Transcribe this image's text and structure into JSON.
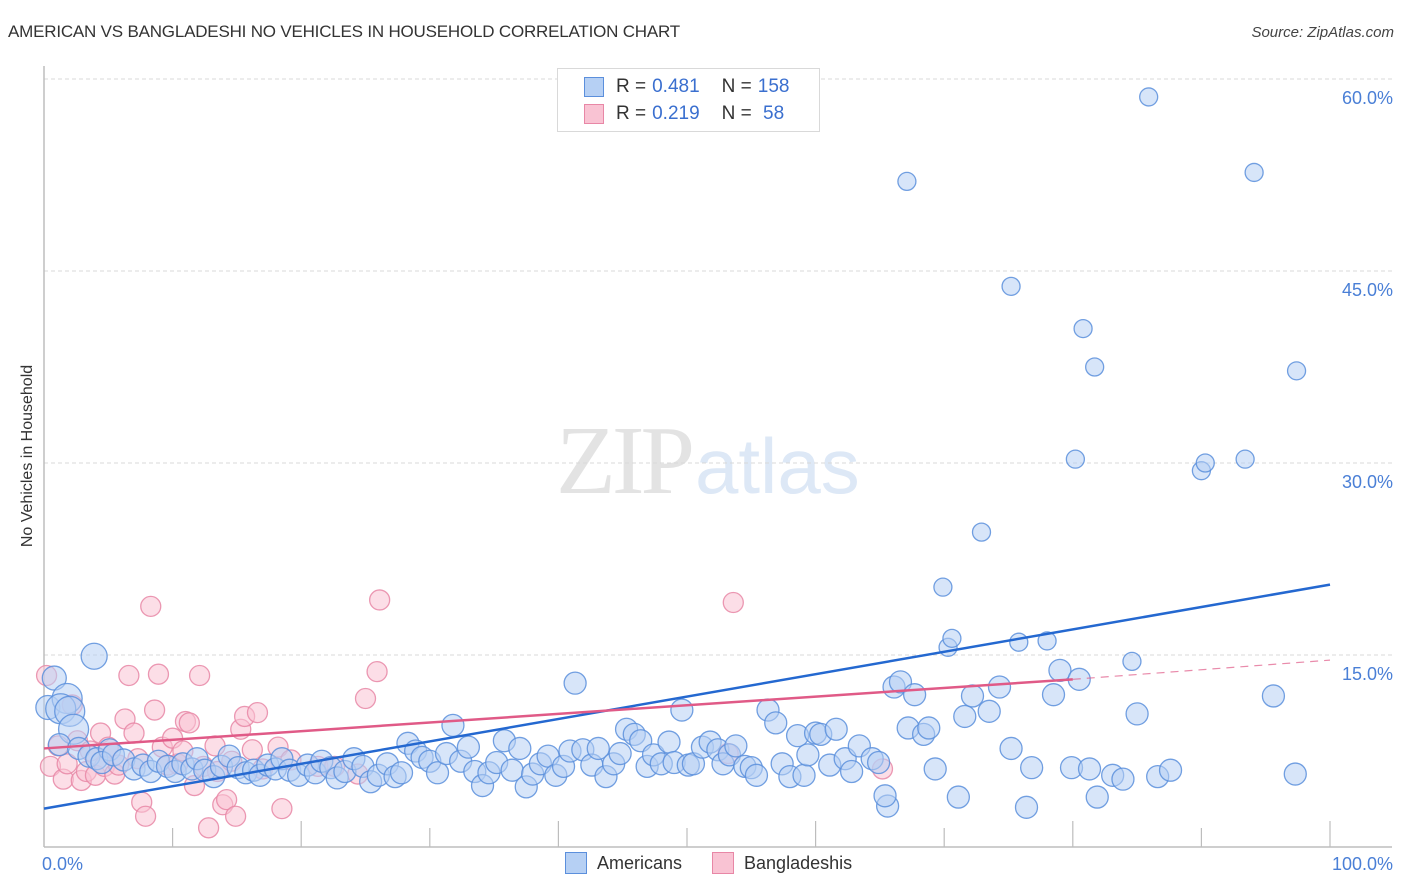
{
  "header": {
    "title": "AMERICAN VS BANGLADESHI NO VEHICLES IN HOUSEHOLD CORRELATION CHART",
    "source": "Source: ZipAtlas.com"
  },
  "watermark": {
    "zip": "ZIP",
    "atlas": "atlas"
  },
  "legend": {
    "rows": [
      {
        "r_label": "R = ",
        "r_value": "0.481",
        "n_label": "N = ",
        "n_value": "158",
        "series": "Americans"
      },
      {
        "r_label": "R = ",
        "r_value": "0.219",
        "n_label": "N = ",
        "n_value": " 58",
        "series": "Bangladeshis"
      }
    ]
  },
  "colors": {
    "americans_fill": "#b6d0f4",
    "americans_stroke": "#5b8fdc",
    "americans_line": "#2468d0",
    "bangladeshis_fill": "#f9c3d3",
    "bangladeshis_stroke": "#e887a6",
    "bangladeshis_line": "#e05a87",
    "tick_label": "#4a7fd6"
  },
  "chart_data": {
    "type": "scatter",
    "title": "AMERICAN VS BANGLADESHI NO VEHICLES IN HOUSEHOLD CORRELATION CHART",
    "xlabel": "",
    "ylabel": "No Vehicles in Household",
    "xlim": [
      0,
      100
    ],
    "ylim": [
      0,
      60
    ],
    "x_tick_labels": [
      {
        "value": 0,
        "label": "0.0%"
      },
      {
        "value": 100,
        "label": "100.0%"
      }
    ],
    "y_tick_labels": [
      {
        "value": 15,
        "label": "15.0%"
      },
      {
        "value": 30,
        "label": "30.0%"
      },
      {
        "value": 45,
        "label": "45.0%"
      },
      {
        "value": 60,
        "label": "60.0%"
      }
    ],
    "y_gridlines": [
      15,
      30,
      45,
      60
    ],
    "grid": true,
    "legend_position": "bottom-center",
    "series": [
      {
        "name": "Americans",
        "R": 0.481,
        "N": 158,
        "trend": {
          "x0": 0,
          "y0": 3.0,
          "x1": 100,
          "y1": 20.5
        },
        "points": [
          [
            0.3,
            10.9
          ],
          [
            0.8,
            13.2
          ],
          [
            1.8,
            11.6
          ],
          [
            1.3,
            10.8
          ],
          [
            2.0,
            10.6
          ],
          [
            2.3,
            9.2
          ],
          [
            1.2,
            8.0
          ],
          [
            3.9,
            14.9
          ],
          [
            2.7,
            7.7
          ],
          [
            3.5,
            7.1
          ],
          [
            4.1,
            6.9
          ],
          [
            5.1,
            7.6
          ],
          [
            4.5,
            6.6
          ],
          [
            5.4,
            7.2
          ],
          [
            6.2,
            6.8
          ],
          [
            7.0,
            6.1
          ],
          [
            7.7,
            6.4
          ],
          [
            8.3,
            5.9
          ],
          [
            8.9,
            6.7
          ],
          [
            9.6,
            6.3
          ],
          [
            10.2,
            5.9
          ],
          [
            10.8,
            6.5
          ],
          [
            11.5,
            6.1
          ],
          [
            11.9,
            6.9
          ],
          [
            12.5,
            6.0
          ],
          [
            13.2,
            5.5
          ],
          [
            13.8,
            6.3
          ],
          [
            14.4,
            7.1
          ],
          [
            15.1,
            6.2
          ],
          [
            15.7,
            5.8
          ],
          [
            16.3,
            6.0
          ],
          [
            16.8,
            5.6
          ],
          [
            17.4,
            6.4
          ],
          [
            18.0,
            6.1
          ],
          [
            18.5,
            6.9
          ],
          [
            19.1,
            6.0
          ],
          [
            19.8,
            5.6
          ],
          [
            20.5,
            6.4
          ],
          [
            21.1,
            5.8
          ],
          [
            21.6,
            6.7
          ],
          [
            22.3,
            6.2
          ],
          [
            22.8,
            5.4
          ],
          [
            23.4,
            5.9
          ],
          [
            24.1,
            6.9
          ],
          [
            24.8,
            6.3
          ],
          [
            25.4,
            5.1
          ],
          [
            26.0,
            5.6
          ],
          [
            26.7,
            6.5
          ],
          [
            27.3,
            5.5
          ],
          [
            27.8,
            5.8
          ],
          [
            28.3,
            8.1
          ],
          [
            28.9,
            7.5
          ],
          [
            29.4,
            7.0
          ],
          [
            30.0,
            6.7
          ],
          [
            30.6,
            5.8
          ],
          [
            31.3,
            7.3
          ],
          [
            31.8,
            9.5
          ],
          [
            32.4,
            6.7
          ],
          [
            33.0,
            7.8
          ],
          [
            33.5,
            5.9
          ],
          [
            34.1,
            4.8
          ],
          [
            34.6,
            5.8
          ],
          [
            35.2,
            6.6
          ],
          [
            35.8,
            8.3
          ],
          [
            36.4,
            6.0
          ],
          [
            37.0,
            7.7
          ],
          [
            37.5,
            4.7
          ],
          [
            38.0,
            5.7
          ],
          [
            38.6,
            6.5
          ],
          [
            39.2,
            7.1
          ],
          [
            39.8,
            5.6
          ],
          [
            40.4,
            6.3
          ],
          [
            40.9,
            7.5
          ],
          [
            41.3,
            12.8
          ],
          [
            41.9,
            7.6
          ],
          [
            42.6,
            6.4
          ],
          [
            43.1,
            7.7
          ],
          [
            43.7,
            5.5
          ],
          [
            44.3,
            6.5
          ],
          [
            44.8,
            7.3
          ],
          [
            45.3,
            9.2
          ],
          [
            45.9,
            8.8
          ],
          [
            46.4,
            8.3
          ],
          [
            46.9,
            6.3
          ],
          [
            47.4,
            7.2
          ],
          [
            48.0,
            6.5
          ],
          [
            48.6,
            8.2
          ],
          [
            49.0,
            6.6
          ],
          [
            49.6,
            10.7
          ],
          [
            50.1,
            6.4
          ],
          [
            50.5,
            6.5
          ],
          [
            51.2,
            7.8
          ],
          [
            51.8,
            8.2
          ],
          [
            52.4,
            7.6
          ],
          [
            52.8,
            6.5
          ],
          [
            53.3,
            7.2
          ],
          [
            53.8,
            7.9
          ],
          [
            54.5,
            6.3
          ],
          [
            55.0,
            6.2
          ],
          [
            55.4,
            5.6
          ],
          [
            56.3,
            10.7
          ],
          [
            56.9,
            9.7
          ],
          [
            57.4,
            6.5
          ],
          [
            58.0,
            5.5
          ],
          [
            58.6,
            8.7
          ],
          [
            59.1,
            5.6
          ],
          [
            59.4,
            7.2
          ],
          [
            60.0,
            8.9
          ],
          [
            60.4,
            8.8
          ],
          [
            61.1,
            6.4
          ],
          [
            61.6,
            9.2
          ],
          [
            62.3,
            6.9
          ],
          [
            62.8,
            5.9
          ],
          [
            63.4,
            7.9
          ],
          [
            64.4,
            6.9
          ],
          [
            64.9,
            6.6
          ],
          [
            65.6,
            3.2
          ],
          [
            65.4,
            4.0
          ],
          [
            66.1,
            12.5
          ],
          [
            66.6,
            12.9
          ],
          [
            67.2,
            9.3
          ],
          [
            67.7,
            11.9
          ],
          [
            68.4,
            8.8
          ],
          [
            68.8,
            9.3
          ],
          [
            69.3,
            6.1
          ],
          [
            69.9,
            20.3
          ],
          [
            70.3,
            15.6
          ],
          [
            70.6,
            16.3
          ],
          [
            71.1,
            3.9
          ],
          [
            71.6,
            10.2
          ],
          [
            72.2,
            11.8
          ],
          [
            72.9,
            24.6
          ],
          [
            73.5,
            10.6
          ],
          [
            74.3,
            12.5
          ],
          [
            75.2,
            7.7
          ],
          [
            75.8,
            16.0
          ],
          [
            76.4,
            3.1
          ],
          [
            76.8,
            6.2
          ],
          [
            78.0,
            16.1
          ],
          [
            78.5,
            11.9
          ],
          [
            79.0,
            13.8
          ],
          [
            79.9,
            6.2
          ],
          [
            80.5,
            13.1
          ],
          [
            81.3,
            6.1
          ],
          [
            81.9,
            3.9
          ],
          [
            83.1,
            5.6
          ],
          [
            83.9,
            5.3
          ],
          [
            84.6,
            14.5
          ],
          [
            85.0,
            10.4
          ],
          [
            86.6,
            5.5
          ],
          [
            87.6,
            6.0
          ],
          [
            90.0,
            29.4
          ],
          [
            90.3,
            30.0
          ],
          [
            80.2,
            30.3
          ],
          [
            80.8,
            40.5
          ],
          [
            81.7,
            37.5
          ],
          [
            75.2,
            43.8
          ],
          [
            67.1,
            52.0
          ],
          [
            85.9,
            58.6
          ],
          [
            94.1,
            52.7
          ],
          [
            93.4,
            30.3
          ],
          [
            97.4,
            37.2
          ],
          [
            95.6,
            11.8
          ],
          [
            97.3,
            5.7
          ]
        ]
      },
      {
        "name": "Bangladeshis",
        "R": 0.219,
        "N": 58,
        "trend": {
          "x0": 0,
          "y0": 7.7,
          "x1": 80,
          "y1": 13.1,
          "dashed_to_x": 100,
          "dashed_to_y": 14.6
        },
        "points": [
          [
            0.2,
            13.4
          ],
          [
            0.5,
            6.3
          ],
          [
            1.1,
            7.9
          ],
          [
            1.5,
            5.3
          ],
          [
            1.8,
            6.5
          ],
          [
            2.2,
            11.1
          ],
          [
            2.6,
            8.3
          ],
          [
            2.9,
            5.2
          ],
          [
            3.3,
            5.9
          ],
          [
            3.6,
            7.5
          ],
          [
            4.0,
            5.6
          ],
          [
            4.4,
            8.9
          ],
          [
            4.7,
            6.3
          ],
          [
            5.0,
            7.8
          ],
          [
            5.5,
            5.7
          ],
          [
            5.8,
            6.4
          ],
          [
            6.3,
            10.0
          ],
          [
            6.6,
            13.4
          ],
          [
            7.0,
            8.9
          ],
          [
            7.3,
            6.9
          ],
          [
            7.6,
            3.5
          ],
          [
            7.9,
            2.4
          ],
          [
            8.3,
            18.8
          ],
          [
            8.6,
            10.7
          ],
          [
            8.9,
            13.5
          ],
          [
            9.2,
            7.8
          ],
          [
            9.6,
            6.4
          ],
          [
            10.0,
            8.5
          ],
          [
            10.4,
            6.5
          ],
          [
            10.8,
            7.5
          ],
          [
            11.0,
            9.8
          ],
          [
            11.3,
            9.7
          ],
          [
            11.7,
            4.8
          ],
          [
            12.1,
            13.4
          ],
          [
            12.4,
            6.3
          ],
          [
            12.8,
            1.5
          ],
          [
            13.3,
            7.9
          ],
          [
            13.5,
            5.9
          ],
          [
            13.9,
            3.3
          ],
          [
            14.2,
            3.7
          ],
          [
            14.6,
            6.7
          ],
          [
            14.9,
            2.4
          ],
          [
            15.3,
            9.2
          ],
          [
            15.6,
            10.2
          ],
          [
            16.2,
            7.6
          ],
          [
            16.6,
            10.5
          ],
          [
            17.0,
            6.1
          ],
          [
            18.2,
            7.8
          ],
          [
            18.5,
            3.0
          ],
          [
            19.2,
            6.8
          ],
          [
            21.3,
            6.3
          ],
          [
            22.6,
            6.3
          ],
          [
            24.4,
            5.7
          ],
          [
            25.0,
            11.6
          ],
          [
            25.9,
            13.7
          ],
          [
            26.1,
            19.3
          ],
          [
            53.2,
            7.3
          ],
          [
            53.6,
            19.1
          ],
          [
            65.2,
            6.1
          ]
        ]
      }
    ]
  }
}
